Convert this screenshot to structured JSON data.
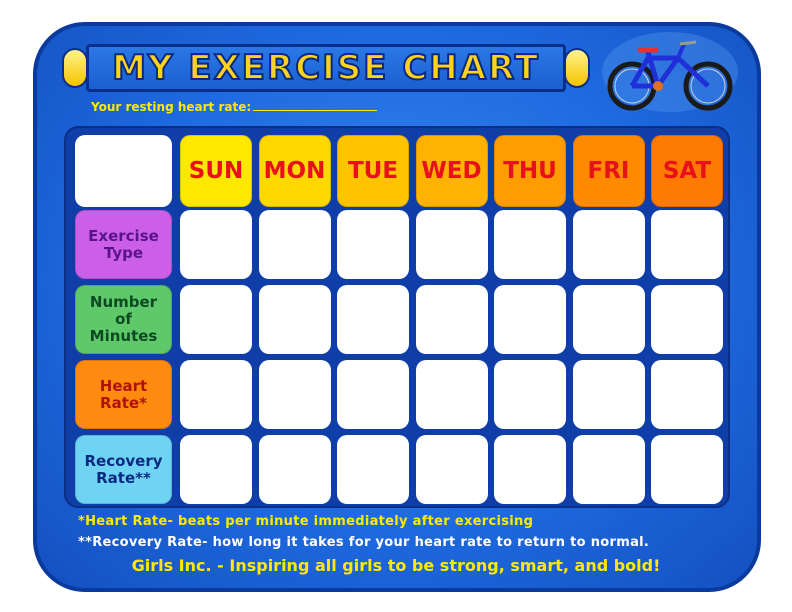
{
  "title": "MY EXERCISE CHART",
  "resting_heart_rate_label": "Your resting heart rate:",
  "days": [
    {
      "label": "SUN",
      "color": "#ffe800"
    },
    {
      "label": "MON",
      "color": "#ffd800"
    },
    {
      "label": "TUE",
      "color": "#ffc400"
    },
    {
      "label": "WED",
      "color": "#ffb300"
    },
    {
      "label": "THU",
      "color": "#ff9d00"
    },
    {
      "label": "FRI",
      "color": "#ff8a00"
    },
    {
      "label": "SAT",
      "color": "#ff7a00"
    }
  ],
  "rows": [
    {
      "line1": "Exercise",
      "line2": "Type",
      "line3": "",
      "color": "#cc5fe8",
      "text_color": "#5a148a"
    },
    {
      "line1": "Number",
      "line2": "of",
      "line3": "Minutes",
      "color": "#5fc86a",
      "text_color": "#0c4a22"
    },
    {
      "line1": "Heart",
      "line2": "Rate*",
      "line3": "",
      "color": "#ff8a10",
      "text_color": "#b0120a"
    },
    {
      "line1": "Recovery",
      "line2": "Rate**",
      "line3": "",
      "color": "#6fd4f4",
      "text_color": "#0a2a80"
    }
  ],
  "notes": {
    "heart_rate": "*Heart Rate- beats per minute immediately after exercising",
    "recovery_rate": "**Recovery Rate- how long it takes for your heart rate to return to normal."
  },
  "footer": "Girls Inc. - Inspiring all girls to be strong, smart, and bold!",
  "icons": {
    "bicycle": "bicycle-icon"
  }
}
